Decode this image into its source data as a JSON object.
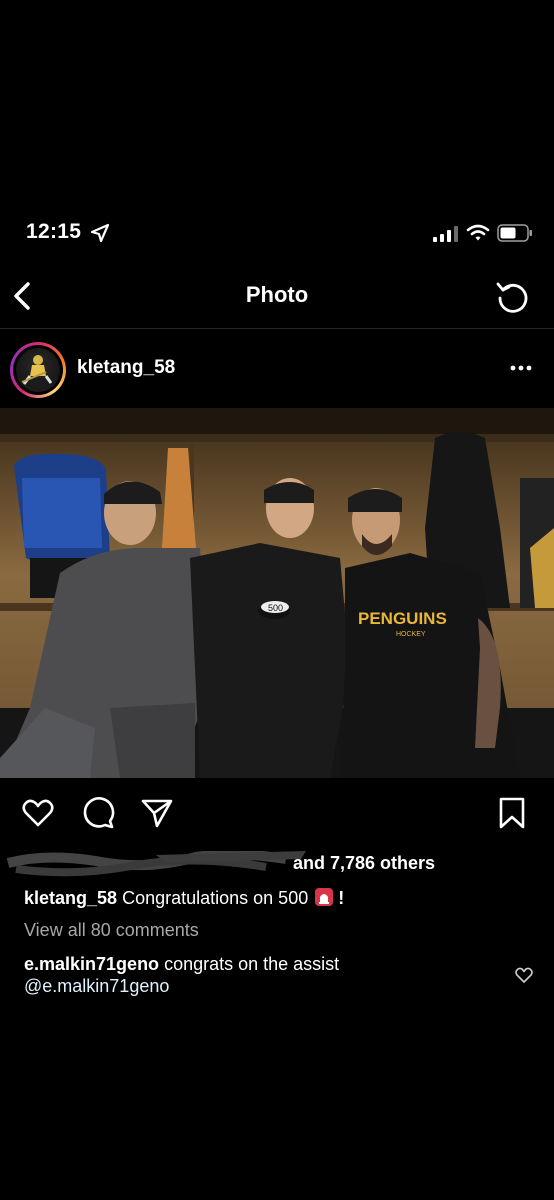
{
  "status_bar": {
    "time": "12:15",
    "location_icon": "location-arrow-icon",
    "signal_icon": "cellular-signal-icon",
    "wifi_icon": "wifi-icon",
    "battery_icon": "battery-icon"
  },
  "nav": {
    "title": "Photo",
    "back_icon": "chevron-left-icon",
    "refresh_icon": "refresh-icon"
  },
  "post": {
    "username": "kletang_58",
    "more_icon": "more-horizontal-icon",
    "photo_puck_text": "500",
    "jersey_text": "PENGUINS",
    "jersey_subtext": "HOCKEY"
  },
  "actions": {
    "like_icon": "heart-icon",
    "comment_icon": "comment-icon",
    "share_icon": "paper-plane-icon",
    "save_icon": "bookmark-icon"
  },
  "likes": {
    "text": "and 7,786 others"
  },
  "caption": {
    "username": "kletang_58",
    "text": "Congratulations on 500",
    "emoji": "rotating-light-emoji",
    "suffix": "!"
  },
  "comments": {
    "view_all": "View all 80 comments",
    "items": [
      {
        "username": "e.malkin71geno",
        "text": "congrats on the assist",
        "mention": "@e.malkin71geno"
      }
    ]
  },
  "colors": {
    "background": "#000000",
    "text": "#ffffff",
    "muted_text": "#a8a8a8"
  }
}
